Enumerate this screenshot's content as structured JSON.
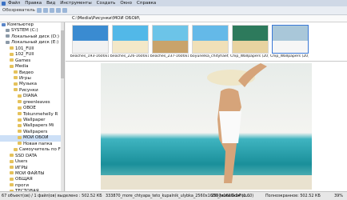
{
  "menu": [
    "Файл",
    "Правка",
    "Вид",
    "Инструменты",
    "Создать",
    "Окно",
    "Справка"
  ],
  "toolbar": {
    "browse_label": "Обозреватель"
  },
  "path": "C:\\Media\\Рисунки\\МОИ ОБОИ\\",
  "tree": [
    {
      "label": "Компьютер",
      "indent": 0,
      "icon": "pc"
    },
    {
      "label": "SYSTEM (C:)",
      "indent": 1,
      "icon": "drive"
    },
    {
      "label": "Локальный диск (D:)",
      "indent": 1,
      "icon": "drive"
    },
    {
      "label": "Локальный диск (E:)",
      "indent": 1,
      "icon": "drive"
    },
    {
      "label": "101_FUll",
      "indent": 2,
      "icon": "folder"
    },
    {
      "label": "102_FUll",
      "indent": 2,
      "icon": "folder"
    },
    {
      "label": "Games",
      "indent": 2,
      "icon": "folder"
    },
    {
      "label": "Media",
      "indent": 2,
      "icon": "folder"
    },
    {
      "label": "Видео",
      "indent": 3,
      "icon": "folder"
    },
    {
      "label": "Игры",
      "indent": 3,
      "icon": "folder"
    },
    {
      "label": "Музыка",
      "indent": 3,
      "icon": "folder"
    },
    {
      "label": "Рисунки",
      "indent": 3,
      "icon": "folder"
    },
    {
      "label": "DIANA",
      "indent": 4,
      "icon": "folder"
    },
    {
      "label": "greenleaves",
      "indent": 4,
      "icon": "folder"
    },
    {
      "label": "OBOE",
      "indent": 4,
      "icon": "folder"
    },
    {
      "label": "Tokunmehelly R",
      "indent": 4,
      "icon": "folder"
    },
    {
      "label": "Wallpaper",
      "indent": 4,
      "icon": "folder"
    },
    {
      "label": "Wallpapers Mi",
      "indent": 4,
      "icon": "folder"
    },
    {
      "label": "Wallpapers",
      "indent": 4,
      "icon": "folder"
    },
    {
      "label": "МОИ ОБОИ",
      "indent": 4,
      "icon": "folder",
      "selected": true
    },
    {
      "label": "Новая папка",
      "indent": 4,
      "icon": "folder"
    },
    {
      "label": "Самоучитель по FL",
      "indent": 3,
      "icon": "folder"
    },
    {
      "label": "SSD DATA",
      "indent": 2,
      "icon": "folder"
    },
    {
      "label": "Users",
      "indent": 2,
      "icon": "folder"
    },
    {
      "label": "ИГРЫ",
      "indent": 2,
      "icon": "folder"
    },
    {
      "label": "МОИ ФАЙЛЫ",
      "indent": 2,
      "icon": "folder"
    },
    {
      "label": "ОБЩАЯ",
      "indent": 2,
      "icon": "folder"
    },
    {
      "label": "проги",
      "indent": 2,
      "icon": "folder"
    },
    {
      "label": "ТЕСТОВАЯ",
      "indent": 2,
      "icon": "folder"
    }
  ],
  "thumbnails": [
    {
      "caption": "beaches_193-1600x1..."
    },
    {
      "caption": "beaches_226-1600x1..."
    },
    {
      "caption": "beaches_237-1600x1..."
    },
    {
      "caption": "boyunelka_chityhaet_..."
    },
    {
      "caption": "Chip_Wallpapers (20)..."
    },
    {
      "caption": "Chip_Wallpapers (20)..."
    }
  ],
  "status": {
    "count": "67 объект(ов) / 1 файл(ов) выделено : 502.52 КБ",
    "file": "333870_more_chtyapa_teto_kupalnik_ulybka_2560x1600_(www.GdeFon...",
    "dims": "2560x1600x24 (1.60)",
    "size": "Полноэкранное: 502.52 КБ",
    "zoom": "39%"
  }
}
